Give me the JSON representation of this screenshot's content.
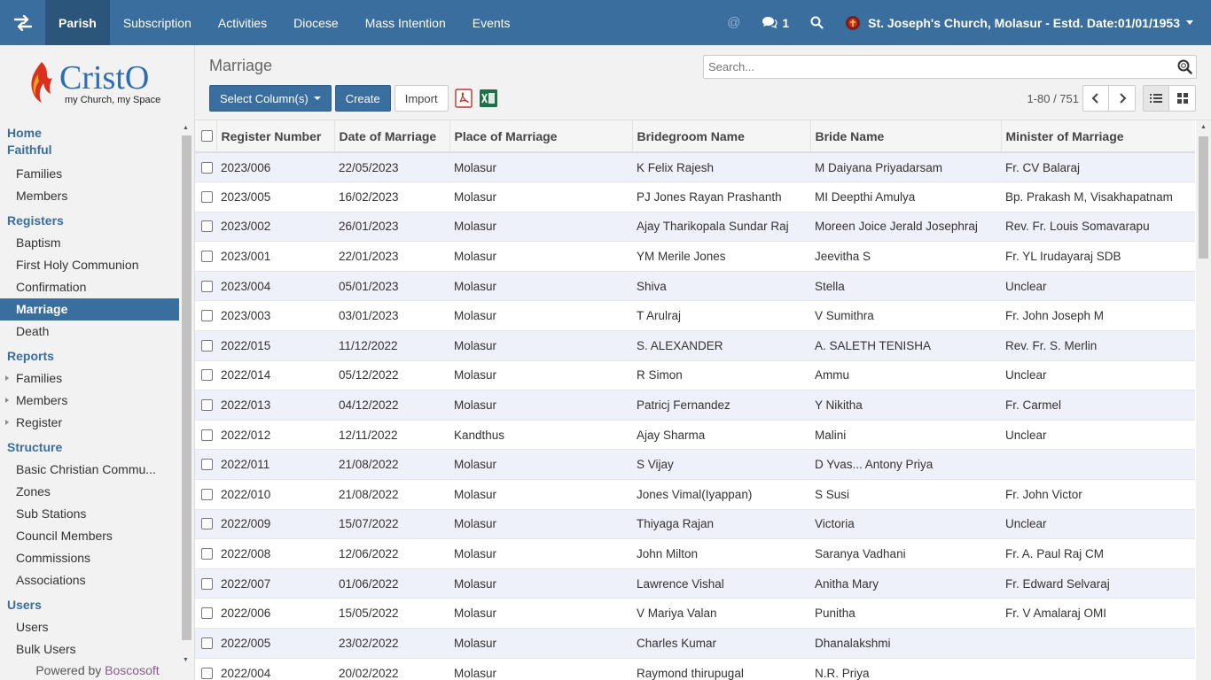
{
  "topnav": {
    "items": [
      "Parish",
      "Subscription",
      "Activities",
      "Diocese",
      "Mass Intention",
      "Events"
    ],
    "active": "Parish",
    "messages_count": "1",
    "church": "St. Joseph's Church, Molasur - Estd. Date:01/01/1953"
  },
  "logo": {
    "name": "CristO",
    "tagline": "my Church, my Space"
  },
  "sidebar": {
    "home": "Home",
    "faithful": {
      "label": "Faithful",
      "items": [
        "Families",
        "Members"
      ]
    },
    "registers": {
      "label": "Registers",
      "items": [
        "Baptism",
        "First Holy Communion",
        "Confirmation",
        "Marriage",
        "Death"
      ],
      "active": "Marriage"
    },
    "reports": {
      "label": "Reports",
      "items": [
        "Families",
        "Members",
        "Register"
      ]
    },
    "structure": {
      "label": "Structure",
      "items": [
        "Basic Christian Commu...",
        "Zones",
        "Sub Stations",
        "Council Members",
        "Commissions",
        "Associations"
      ]
    },
    "users": {
      "label": "Users",
      "items": [
        "Users",
        "Bulk Users"
      ]
    },
    "powered_prefix": "Powered by",
    "powered_brand": "Boscosoft"
  },
  "page": {
    "title": "Marriage",
    "search_placeholder": "Search...",
    "select_columns": "Select Column(s)",
    "create": "Create",
    "import": "Import",
    "pager": "1-80 / 751"
  },
  "table": {
    "columns": [
      "Register Number",
      "Date of Marriage",
      "Place of Marriage",
      "Bridegroom Name",
      "Bride Name",
      "Minister of Marriage"
    ],
    "rows": [
      [
        "2023/006",
        "22/05/2023",
        "Molasur",
        "K Felix Rajesh",
        "M Daiyana Priyadarsam",
        "Fr. CV Balaraj"
      ],
      [
        "2023/005",
        "16/02/2023",
        "Molasur",
        "PJ Jones Rayan Prashanth",
        "MI Deepthi Amulya",
        "Bp. Prakash M, Visakhapatnam"
      ],
      [
        "2023/002",
        "26/01/2023",
        "Molasur",
        "Ajay Tharikopala Sundar Raj",
        "Moreen Joice Jerald Josephraj",
        "Rev. Fr. Louis Somavarapu"
      ],
      [
        "2023/001",
        "22/01/2023",
        "Molasur",
        "YM Merile Jones",
        "Jeevitha S",
        "Fr. YL Irudayaraj SDB"
      ],
      [
        "2023/004",
        "05/01/2023",
        "Molasur",
        "Shiva",
        "Stella",
        "Unclear"
      ],
      [
        "2023/003",
        "03/01/2023",
        "Molasur",
        "T Arulraj",
        "V Sumithra",
        "Fr. John Joseph M"
      ],
      [
        "2022/015",
        "11/12/2022",
        "Molasur",
        "S. ALEXANDER",
        "A. SALETH TENISHA",
        "Rev. Fr. S. Merlin"
      ],
      [
        "2022/014",
        "05/12/2022",
        "Molasur",
        "R Simon",
        "Ammu",
        "Unclear"
      ],
      [
        "2022/013",
        "04/12/2022",
        "Molasur",
        "Patricj Fernandez",
        "Y Nikitha",
        "Fr. Carmel"
      ],
      [
        "2022/012",
        "12/11/2022",
        "Kandthus",
        "Ajay Sharma",
        "Malini",
        "Unclear"
      ],
      [
        "2022/011",
        "21/08/2022",
        "Molasur",
        "S Vijay",
        "D Yvas... Antony Priya",
        ""
      ],
      [
        "2022/010",
        "21/08/2022",
        "Molasur",
        "Jones Vimal(Iyappan)",
        "S Susi",
        "Fr. John Victor"
      ],
      [
        "2022/009",
        "15/07/2022",
        "Molasur",
        "Thiyaga Rajan",
        "Victoria",
        "Unclear"
      ],
      [
        "2022/008",
        "12/06/2022",
        "Molasur",
        "John Milton",
        "Saranya Vadhani",
        "Fr. A. Paul Raj CM"
      ],
      [
        "2022/007",
        "01/06/2022",
        "Molasur",
        "Lawrence Vishal",
        "Anitha Mary",
        "Fr. Edward Selvaraj"
      ],
      [
        "2022/006",
        "15/05/2022",
        "Molasur",
        "V Mariya Valan",
        "Punitha",
        "Fr. V Amalaraj OMI"
      ],
      [
        "2022/005",
        "23/02/2022",
        "Molasur",
        "Charles Kumar",
        "Dhanalakshmi",
        ""
      ],
      [
        "2022/004",
        "20/02/2022",
        "Molasur",
        "Raymond thirupugal",
        "N.R. Priya",
        ""
      ]
    ]
  },
  "colors": {
    "brand": "#3a6e9e",
    "row_alt": "#eef1f9",
    "logo_red": "#d9311b",
    "logo_blue": "#2a6db5"
  }
}
